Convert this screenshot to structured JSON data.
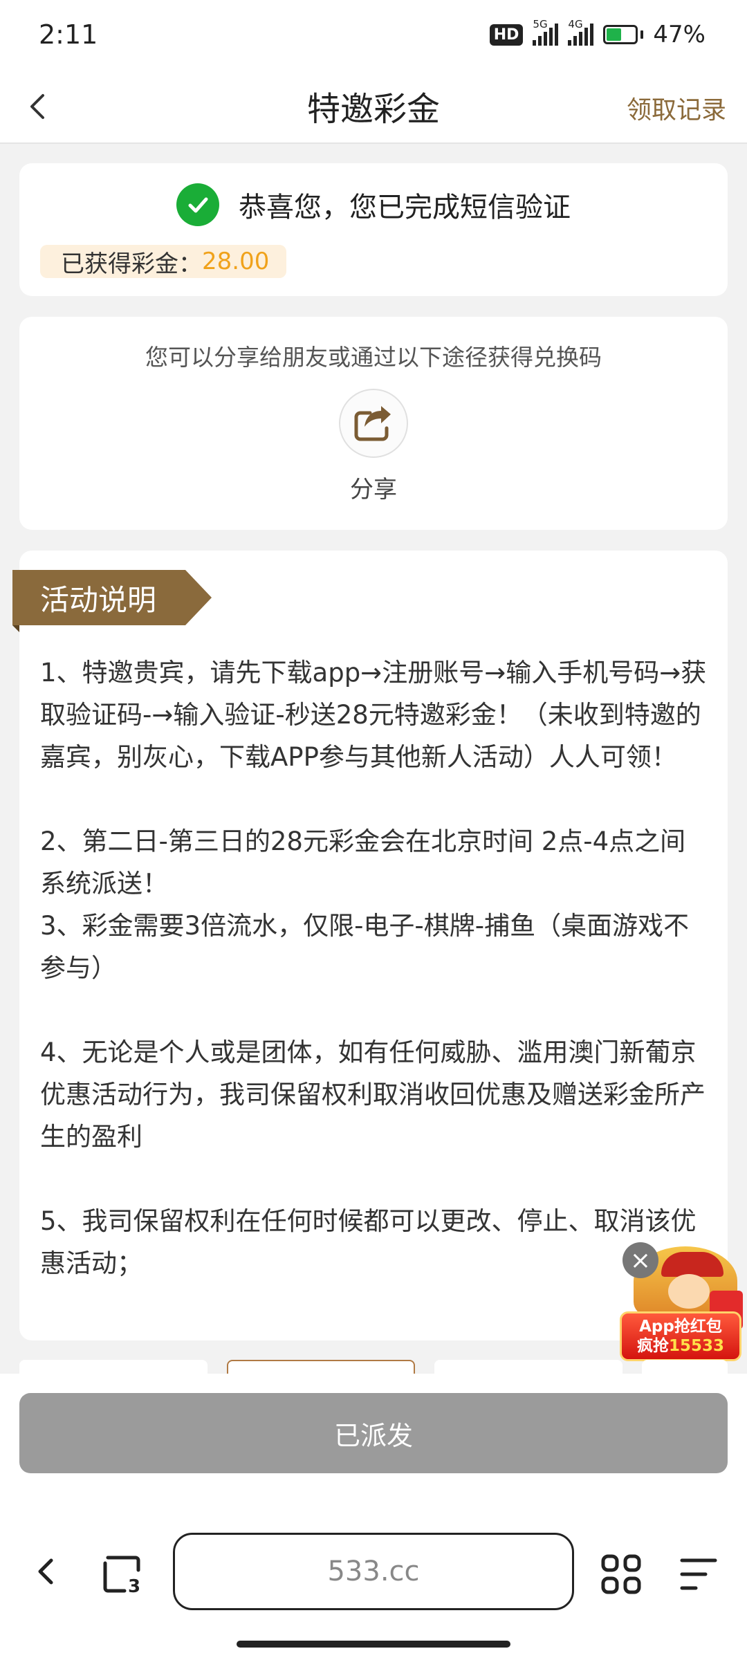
{
  "status_bar": {
    "time": "2:11",
    "hd_badge": "HD",
    "signal1_label": "5G",
    "signal2_label": "4G",
    "battery_percent": "47%",
    "battery_level": 0.47
  },
  "header": {
    "title": "特邀彩金",
    "record_link": "领取记录"
  },
  "verification": {
    "message": "恭喜您，您已完成短信验证",
    "earned_label": "已获得彩金：",
    "earned_value": "28.00",
    "success_color": "#1aad37",
    "accent_color": "#f0a21b"
  },
  "share": {
    "description": "您可以分享给朋友或通过以下途径获得兑换码",
    "label": "分享"
  },
  "rules": {
    "title": "活动说明",
    "text": "1、特邀贵宾，请先下载app→注册账号→输入手机号码→获取验证码-→输入验证-秒送28元特邀彩金！（未收到特邀的嘉宾，别灰心，下载APP参与其他新人活动）人人可领！\n\n2、第二日-第三日的28元彩金会在北京时间 2点-4点之间系统派送！\n3、彩金需要3倍流水，仅限-电子-棋牌-捕鱼（桌面游戏不参与）\n\n4、无论是个人或是团体，如有任何威胁、滥用澳门新葡京优惠活动行为，我司保留权利取消收回优惠及赠送彩金所产生的盈利\n\n5、我司保留权利在任何时候都可以更改、停止、取消该优惠活动；",
    "tag_color": "#8a6a3c"
  },
  "float_ad": {
    "line1": "App抢红包",
    "line2_prefix": "疯抢",
    "line2_number": "15533"
  },
  "action": {
    "button_label": "已派发",
    "button_color": "#9b9b9b"
  },
  "browser": {
    "url": "533.cc",
    "tab_count": "3"
  }
}
